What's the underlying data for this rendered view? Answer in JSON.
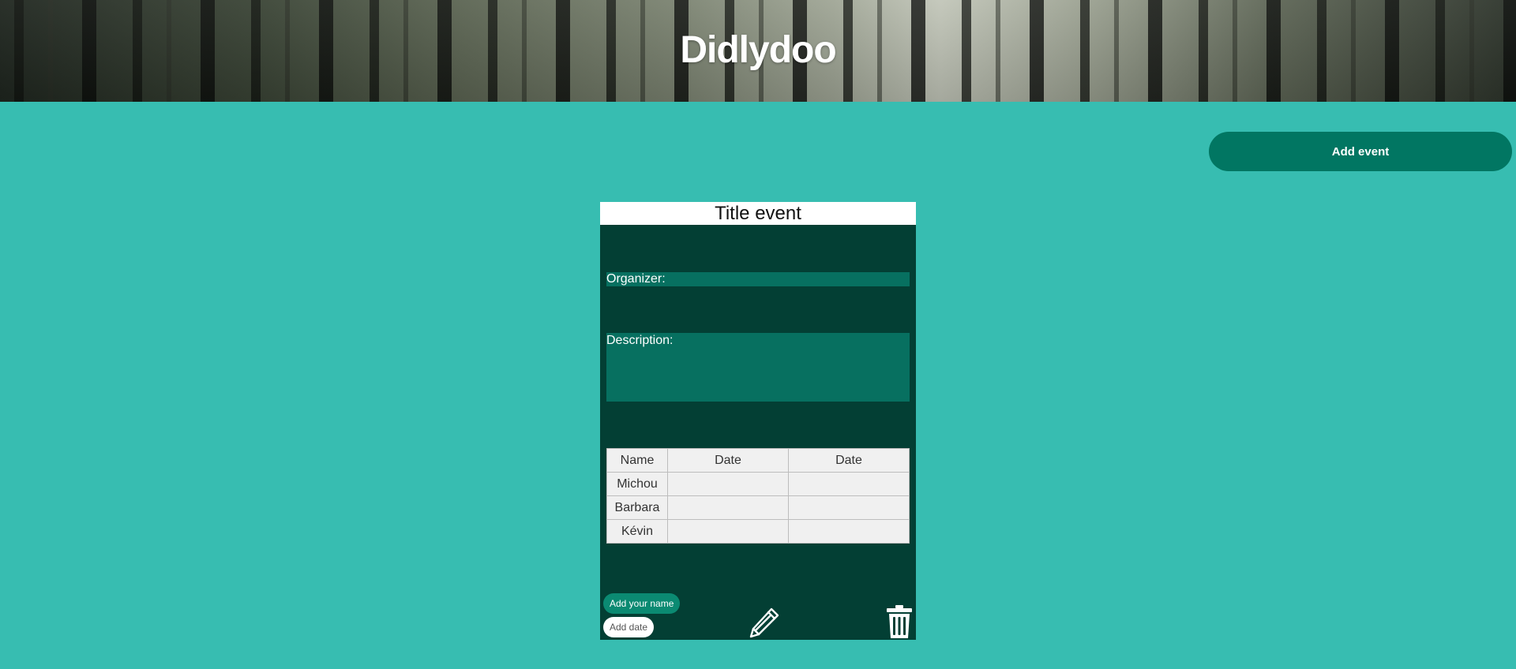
{
  "header": {
    "title": "Didlydoo"
  },
  "toolbar": {
    "add_event_label": "Add event"
  },
  "event": {
    "title": "Title event",
    "organizer_label": "Organizer:",
    "description_label": "Description:",
    "table": {
      "headers": [
        "Name",
        "Date",
        "Date"
      ],
      "rows": [
        {
          "name": "Michou",
          "cells": [
            "",
            ""
          ]
        },
        {
          "name": "Barbara",
          "cells": [
            "",
            ""
          ]
        },
        {
          "name": "Kévin",
          "cells": [
            "",
            ""
          ]
        }
      ]
    },
    "add_name_label": "Add your name",
    "add_date_label": "Add date",
    "icons": {
      "edit": "pencil-icon",
      "delete": "trash-icon"
    }
  },
  "colors": {
    "background": "#37bdb1",
    "card": "#033f34",
    "field": "#077060",
    "button": "#017662"
  }
}
